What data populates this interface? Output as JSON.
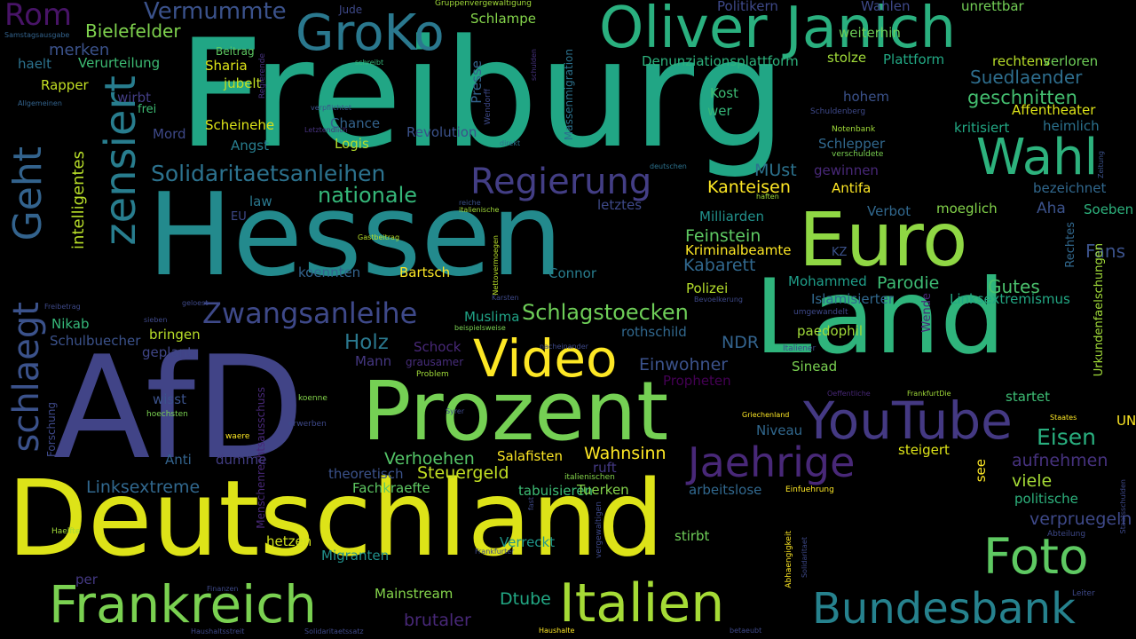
{
  "words": [
    {
      "t": "Freiburg",
      "c": "#21a685"
    },
    {
      "t": "Hessen",
      "c": "#238a8d"
    },
    {
      "t": "Land",
      "c": "#2fb47c"
    },
    {
      "t": "AfD",
      "c": "#414487"
    },
    {
      "t": "Deutschland",
      "c": "#dde318"
    },
    {
      "t": "Prozent",
      "c": "#75d054"
    },
    {
      "t": "Euro",
      "c": "#8fd744"
    },
    {
      "t": "Oliver Janich",
      "c": "#2ab07f"
    },
    {
      "t": "GroKo",
      "c": "#2a788e"
    },
    {
      "t": "Video",
      "c": "#fde725"
    },
    {
      "t": "YouTube",
      "c": "#443983"
    },
    {
      "t": "Jaehrige",
      "c": "#482878"
    },
    {
      "t": "Foto",
      "c": "#5ec962"
    },
    {
      "t": "Frankreich",
      "c": "#7ad151"
    },
    {
      "t": "Italien",
      "c": "#a5db36"
    },
    {
      "t": "Bundesbank",
      "c": "#26828e"
    },
    {
      "t": "Wahl",
      "c": "#2db27d"
    },
    {
      "t": "zensiert",
      "c": "#287d8e"
    },
    {
      "t": "schlaegt",
      "c": "#3b528b"
    },
    {
      "t": "Geht",
      "c": "#33638d"
    },
    {
      "t": "Regierung",
      "c": "#433e85"
    },
    {
      "t": "Rom",
      "c": "#481467"
    },
    {
      "t": "Vermummte",
      "c": "#3b528b"
    },
    {
      "t": "Zwangsanleihe",
      "c": "#3e4989"
    },
    {
      "t": "Solidaritaetsanleihen",
      "c": "#2c728e"
    },
    {
      "t": "nationale",
      "c": "#35b779"
    },
    {
      "t": "Schlagstoecken",
      "c": "#6ece58"
    },
    {
      "t": "Suedlaender",
      "c": "#2e6e8e"
    },
    {
      "t": "geschnitten",
      "c": "#44bf70"
    },
    {
      "t": "Eisen",
      "c": "#29af7f"
    },
    {
      "t": "Linksextreme",
      "c": "#31688e"
    },
    {
      "t": "Steuergeld",
      "c": "#c2df23"
    },
    {
      "t": "Verhoehen",
      "c": "#54c568"
    },
    {
      "t": "Holz",
      "c": "#2a788e"
    },
    {
      "t": "Einwohner",
      "c": "#3b528b"
    },
    {
      "t": "Bielefelder",
      "c": "#7fd34e"
    },
    {
      "t": "merken",
      "c": "#3b528b"
    },
    {
      "t": "intelligentes",
      "c": "#b8de29"
    },
    {
      "t": "Parodie",
      "c": "#3dbc74"
    },
    {
      "t": "Gutes",
      "c": "#4ac16d"
    },
    {
      "t": "Kabarett",
      "c": "#31688e"
    },
    {
      "t": "Feinstein",
      "c": "#5ec962"
    },
    {
      "t": "Kanteisen",
      "c": "#fde725"
    },
    {
      "t": "MUst",
      "c": "#2c728e"
    },
    {
      "t": "Affentheater",
      "c": "#dde318"
    },
    {
      "t": "Wahnsinn",
      "c": "#fde725"
    },
    {
      "t": "Salafisten",
      "c": "#fde725"
    },
    {
      "t": "aufnehmen",
      "c": "#46327e"
    },
    {
      "t": "verpruegeln",
      "c": "#3e4989"
    },
    {
      "t": "Mainstream",
      "c": "#84d44b"
    },
    {
      "t": "brutaler",
      "c": "#482878"
    },
    {
      "t": "Dtube",
      "c": "#22a884"
    },
    {
      "t": "Migranten",
      "c": "#21918c"
    },
    {
      "t": "Verreckt",
      "c": "#1f978b"
    },
    {
      "t": "stirbt",
      "c": "#6ece58"
    },
    {
      "t": "viele",
      "c": "#a5db36"
    },
    {
      "t": "politische",
      "c": "#2db27d"
    },
    {
      "t": "Fans",
      "c": "#3b528b"
    },
    {
      "t": "Mann",
      "c": "#453781"
    },
    {
      "t": "NDR",
      "c": "#33638d"
    },
    {
      "t": "Nikab",
      "c": "#35b779"
    },
    {
      "t": "Schulbuecher",
      "c": "#3b528b"
    },
    {
      "t": "Verurteilung",
      "c": "#3dbc74"
    },
    {
      "t": "haelt",
      "c": "#2c728e"
    },
    {
      "t": "Rapper",
      "c": "#c2df23"
    },
    {
      "t": "Sharia",
      "c": "#dde318"
    },
    {
      "t": "jubelt",
      "c": "#c2df23"
    },
    {
      "t": "Scheinehe",
      "c": "#dde318"
    },
    {
      "t": "Angst",
      "c": "#287d8e"
    },
    {
      "t": "Chance",
      "c": "#33638d"
    },
    {
      "t": "Logis",
      "c": "#b5de2b"
    },
    {
      "t": "Revolution",
      "c": "#3b528b"
    },
    {
      "t": "Schlampe",
      "c": "#84d44b"
    },
    {
      "t": "Politikern",
      "c": "#3e4989"
    },
    {
      "t": "Wahlen",
      "c": "#3e4989"
    },
    {
      "t": "unrettbar",
      "c": "#73d056"
    },
    {
      "t": "weiterhin",
      "c": "#6ece58"
    },
    {
      "t": "stolze",
      "c": "#a0da39"
    },
    {
      "t": "Plattform",
      "c": "#22a884"
    },
    {
      "t": "rechtens",
      "c": "#b8de29"
    },
    {
      "t": "verloren",
      "c": "#6ece58"
    },
    {
      "t": "Denunziationsplattform",
      "c": "#2db27d"
    },
    {
      "t": "Kost",
      "c": "#3dbc74"
    },
    {
      "t": "wer",
      "c": "#35b779"
    },
    {
      "t": "hohem",
      "c": "#3b528b"
    },
    {
      "t": "kritisiert",
      "c": "#22a884"
    },
    {
      "t": "heimlich",
      "c": "#2c728e"
    },
    {
      "t": "Schlepper",
      "c": "#31688e"
    },
    {
      "t": "gewinnen",
      "c": "#482878"
    },
    {
      "t": "Antifa",
      "c": "#fde725"
    },
    {
      "t": "bezeichnet",
      "c": "#31688e"
    },
    {
      "t": "Verbot",
      "c": "#31688e"
    },
    {
      "t": "moeglich",
      "c": "#84d44b"
    },
    {
      "t": "Aha",
      "c": "#3b528b"
    },
    {
      "t": "Soeben",
      "c": "#2db27d"
    },
    {
      "t": "law",
      "c": "#2a788e"
    },
    {
      "t": "letztes",
      "c": "#3e4989"
    },
    {
      "t": "Milliarden",
      "c": "#21918c"
    },
    {
      "t": "Kriminalbeamte",
      "c": "#fde725"
    },
    {
      "t": "koennten",
      "c": "#33638d"
    },
    {
      "t": "Bartsch",
      "c": "#fde725"
    },
    {
      "t": "Connor",
      "c": "#287d8e"
    },
    {
      "t": "Polizei",
      "c": "#b5de2b"
    },
    {
      "t": "Mohammed",
      "c": "#1f9e89"
    },
    {
      "t": "Islamisierter",
      "c": "#31688e"
    },
    {
      "t": "Linksextremismus",
      "c": "#22a884"
    },
    {
      "t": "paedophil",
      "c": "#a0da39"
    },
    {
      "t": "rothschild",
      "c": "#31688e"
    },
    {
      "t": "Sinead",
      "c": "#7ad151"
    },
    {
      "t": "Propheten",
      "c": "#440154"
    },
    {
      "t": "startet",
      "c": "#3dbc74"
    },
    {
      "t": "Muslima",
      "c": "#20a386"
    },
    {
      "t": "Schock",
      "c": "#482878"
    },
    {
      "t": "grausamer",
      "c": "#472d7b"
    },
    {
      "t": "bringen",
      "c": "#b8de29"
    },
    {
      "t": "geplant",
      "c": "#404688"
    },
    {
      "t": "wisst",
      "c": "#3b528b"
    },
    {
      "t": "Anti",
      "c": "#33638d"
    },
    {
      "t": "dumme",
      "c": "#433e85"
    },
    {
      "t": "theoretisch",
      "c": "#3b528b"
    },
    {
      "t": "Fachkraefte",
      "c": "#5ec962"
    },
    {
      "t": "tabuisieren",
      "c": "#3dbc74"
    },
    {
      "t": "Tuerken",
      "c": "#84d44b"
    },
    {
      "t": "arbeitslose",
      "c": "#31688e"
    },
    {
      "t": "steigert",
      "c": "#dde318"
    },
    {
      "t": "Niveau",
      "c": "#31688e"
    },
    {
      "t": "see",
      "c": "#fde725"
    },
    {
      "t": "hetzen",
      "c": "#d0e11c"
    },
    {
      "t": "per",
      "c": "#443983"
    },
    {
      "t": "Forschung",
      "c": "#3e4989"
    },
    {
      "t": "wirbt",
      "c": "#433e85"
    },
    {
      "t": "frei",
      "c": "#3dbc74"
    },
    {
      "t": "Mord",
      "c": "#3e4989"
    },
    {
      "t": "Beitrag",
      "c": "#5ec962"
    },
    {
      "t": "Jude",
      "c": "#3e4989"
    },
    {
      "t": "Presse",
      "c": "#33638d"
    },
    {
      "t": "Massenmigration",
      "c": "#2c728e"
    },
    {
      "t": "Rechtes",
      "c": "#31688e"
    },
    {
      "t": "Urkundenfaelschungen",
      "c": "#a0da39"
    },
    {
      "t": "UN",
      "c": "#fde725"
    },
    {
      "t": "ruft",
      "c": "#443983"
    },
    {
      "t": "Menschenrechtsausschuss",
      "c": "#482878"
    },
    {
      "t": "EU",
      "c": "#3e4989"
    },
    {
      "t": "KZ",
      "c": "#3b528b"
    },
    {
      "t": "Wende",
      "c": "#482878"
    },
    {
      "t": "Gruppenvergewaltigung",
      "c": "#a0da39"
    },
    {
      "t": "Samstagsausgabe",
      "c": "#33638d"
    },
    {
      "t": "Allgemeinen",
      "c": "#33638d"
    },
    {
      "t": "schreibt",
      "c": "#35b779"
    },
    {
      "t": "Regierende",
      "c": "#46327e"
    },
    {
      "t": "verpflichtet",
      "c": "#3b528b"
    },
    {
      "t": "Letztendlich",
      "c": "#46327e"
    },
    {
      "t": "Wendorff",
      "c": "#3e4989"
    },
    {
      "t": "direkt",
      "c": "#2c728e"
    },
    {
      "t": "deutschen",
      "c": "#2c728e"
    },
    {
      "t": "Schuldenberg",
      "c": "#3e4989"
    },
    {
      "t": "Notenbank",
      "c": "#a0da39"
    },
    {
      "t": "verschuldete",
      "c": "#7ad151"
    },
    {
      "t": "schulden",
      "c": "#46327e"
    },
    {
      "t": "Zeitung",
      "c": "#3b528b"
    },
    {
      "t": "haften",
      "c": "#a0da39"
    },
    {
      "t": "reiche",
      "c": "#3b528b"
    },
    {
      "t": "italienische",
      "c": "#a0da39"
    },
    {
      "t": "Gastbeitrag",
      "c": "#b5de2b"
    },
    {
      "t": "Nettovermoegen",
      "c": "#b8de29"
    },
    {
      "t": "geloest",
      "c": "#3e4989"
    },
    {
      "t": "Freibetrag",
      "c": "#3e4989"
    },
    {
      "t": "sieben",
      "c": "#3e4989"
    },
    {
      "t": "Karsten",
      "c": "#3e4989"
    },
    {
      "t": "beispielsweise",
      "c": "#7ad151"
    },
    {
      "t": "Bevoelkerung",
      "c": "#3e4989"
    },
    {
      "t": "umgewandelt",
      "c": "#3e4989"
    },
    {
      "t": "nacheinander",
      "c": "#3e4989"
    },
    {
      "t": "Italiener",
      "c": "#3e4989"
    },
    {
      "t": "Problem",
      "c": "#a0da39"
    },
    {
      "t": "Oeffentliche",
      "c": "#482878"
    },
    {
      "t": "FrankfurtDie",
      "c": "#a0da39"
    },
    {
      "t": "Staates",
      "c": "#fde725"
    },
    {
      "t": "Griechenland",
      "c": "#fde725"
    },
    {
      "t": "hoechsten",
      "c": "#7ad151"
    },
    {
      "t": "koenne",
      "c": "#84d44b"
    },
    {
      "t": "erwerben",
      "c": "#3e4989"
    },
    {
      "t": "waere",
      "c": "#fde725"
    },
    {
      "t": "Syrer",
      "c": "#3e4989"
    },
    {
      "t": "italienischen",
      "c": "#84d44b"
    },
    {
      "t": "Frankfurter",
      "c": "#3e4989"
    },
    {
      "t": "vergewaltigen",
      "c": "#3e4989"
    },
    {
      "t": "fast",
      "c": "#3e4989"
    },
    {
      "t": "Einfuehrung",
      "c": "#fde725"
    },
    {
      "t": "Abhaengigkeit",
      "c": "#fde725"
    },
    {
      "t": "Solidaritaet",
      "c": "#3e4989"
    },
    {
      "t": "Staatsschulden",
      "c": "#3e4989"
    },
    {
      "t": "Abteilung",
      "c": "#3e4989"
    },
    {
      "t": "Haelfte",
      "c": "#a0da39"
    },
    {
      "t": "Finanzen",
      "c": "#3e4989"
    },
    {
      "t": "Haushaltsstreit",
      "c": "#3e4989"
    },
    {
      "t": "Solidaritaetssatz",
      "c": "#3e4989"
    },
    {
      "t": "Haushalte",
      "c": "#fde725"
    },
    {
      "t": "betaeubt",
      "c": "#3e4989"
    },
    {
      "t": "Leiter",
      "c": "#3e4989"
    }
  ]
}
